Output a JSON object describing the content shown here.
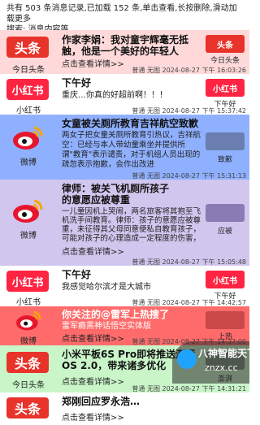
{
  "header": {
    "line1": "共有 503 条消息记录,已加载 152 条,单击查看,长按删除,滑动加载更多",
    "line2": "搜索: 消息内容等"
  },
  "brand": {
    "toutiao": "#e8332a",
    "xiaohongshu": "#ff2442",
    "weibo_red": "#e6162d",
    "weibo_yellow": "#f7a600"
  },
  "cards": [
    {
      "bg": "#ffd9d9",
      "app_icon": "toutiao-logo",
      "app_label": "头条",
      "app_name": "今日头条",
      "title": "作家李娟：我对童宇辉毫无抵触，他是一个美好的年轻人",
      "body": "",
      "more": "点击查看详情>>",
      "meta": "普通 无图 2024-08-27 下午 16:03:26",
      "thumb_label": "头条",
      "thumb_caption": "今日头条"
    },
    {
      "bg": "#ffffff",
      "app_icon": "xiaohongshu-logo",
      "app_label": "小红书",
      "app_name": "小红书",
      "title": "下午好",
      "body": "重庆…你真的好超前啊！！！",
      "more": "",
      "meta": "普通 无图 2024-08-27 下午 15:37:42",
      "thumb_label": "小红书",
      "thumb_caption": "下午好"
    },
    {
      "bg": "#8fb0ff",
      "app_icon": "weibo-logo",
      "app_label": "",
      "app_name": "微博",
      "title": "女童被关厕所教育吉祥航空致歉",
      "body": "两女子把女童关厕所教育引热议，吉祥航空：已经与本人带幼童乘坐并提供所谓\"教育\"表示谴责，对于机组人员出现的疏忽表示抱歉，会作出改进",
      "more": "",
      "meta": "普通 无图 2024-08-27 下午 15:31:13",
      "thumb_label": "",
      "thumb_caption": "致歉"
    },
    {
      "bg": "#d0c6ee",
      "app_icon": "weibo-logo",
      "app_label": "",
      "app_name": "微博",
      "title": "律师：被关飞机厕所孩子的意愿应被尊重",
      "body": "一儿童因机上哭闹，两名旅客将其抱至飞机洗手间教育。律师：孩子的意愿应被尊重，未征得其父母同意便私自教育孩子，可能对孩子的心理造成一定程度的伤害，社区、如未经当事人同意，属侵犯肖像权",
      "more": "点击查看详情>>",
      "meta": "普通 无图 2024-08-27 下午 15:05:48",
      "thumb_label": "",
      "thumb_caption": "应被"
    },
    {
      "bg": "#ffffff",
      "app_icon": "xiaohongshu-logo",
      "app_label": "小红书",
      "app_name": "小红书",
      "title": "下午好",
      "body": "我感觉哈尔滨才是大城市",
      "more": "",
      "meta": "普通 无图 2024-08-27 下午 14:42:57",
      "thumb_label": "小红书",
      "thumb_caption": "下午好"
    },
    {
      "bg": "#ff6b6b",
      "app_icon": "weibo-logo",
      "app_label": "",
      "app_name": "微博",
      "title": "你关注的@雷军上热搜了",
      "body": "雷军瘾黑神话悟空实体版",
      "more": "点击查看详情>>",
      "meta": "普通 无图 2024-08-27 下午 14:37:00",
      "thumb_label": "",
      "thumb_caption": "上热"
    },
    {
      "bg": "#c9f5c9",
      "app_icon": "toutiao-logo",
      "app_label": "头条",
      "app_name": "今日头条",
      "title": "小米平板6S Pro即将推送澎湃OS 2.0，带来诸多优化",
      "body": "",
      "more": "点击查看详情>>",
      "meta": "普通 无图 2024-08-27 下午 14:31:21",
      "thumb_label": "",
      "thumb_caption": "澎湃"
    },
    {
      "bg": "#ffffff",
      "app_icon": "toutiao-logo",
      "app_label": "头条",
      "app_name": "今日头条",
      "title": "郑刚回应罗永浩…",
      "body": "",
      "more": "点击查看详情>>",
      "meta": "",
      "thumb_label": "",
      "thumb_caption": ""
    }
  ],
  "watermark": {
    "text": "八神智能天下",
    "url": "znzx.cc"
  }
}
